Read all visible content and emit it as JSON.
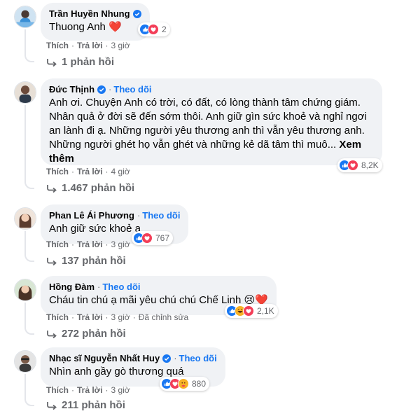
{
  "colors": {
    "brand_blue": "#1877f2",
    "bubble_bg": "#f0f2f5",
    "muted": "#65676b",
    "love_red": "#f33e58"
  },
  "labels": {
    "like": "Thích",
    "reply": "Trả lời",
    "follow": "Theo dõi",
    "see_more": "Xem thêm",
    "separator": "·"
  },
  "comments": [
    {
      "name": "Trần Huyền Nhung",
      "verified": true,
      "follow": false,
      "text": "Thuong Anh ❤️",
      "reactions": [
        "like-icon",
        "love-icon"
      ],
      "reaction_count": "2",
      "time": "3 giờ",
      "edited": "",
      "replies": "1 phản hồi"
    },
    {
      "name": "Đức Thịnh",
      "verified": true,
      "follow": true,
      "text": "Anh ơi. Chuyện Anh có trời, có đất, có lòng thành tâm chứng giám. Nhân quả ở đời sẽ đến sớm thôi. Anh giữ gìn sức khoẻ và nghỉ ngơi an lành đi ạ. Những người yêu thương anh thì vẫn yêu thương anh. Những người ghét họ vẫn ghét và những kẻ dã tâm thì muô...",
      "reactions": [
        "like-icon",
        "love-icon"
      ],
      "reaction_count": "8,2K",
      "time": "4 giờ",
      "edited": "",
      "replies": "1.467 phản hồi"
    },
    {
      "name": "Phan Lê Ái Phương",
      "verified": false,
      "follow": true,
      "text": "Anh giữ sức khoẻ ạ",
      "reactions": [
        "like-icon",
        "love-icon"
      ],
      "reaction_count": "767",
      "time": "3 giờ",
      "edited": "",
      "replies": "137 phản hồi"
    },
    {
      "name": "Hồng Đàm",
      "verified": false,
      "follow": true,
      "text": "Cháu tin chú ạ mãi yêu chú chú Chế Linh 😢❤️",
      "reactions": [
        "like-icon",
        "haha-icon",
        "love-icon"
      ],
      "reaction_count": "2,1K",
      "time": "3 giờ",
      "edited": "Đã chỉnh sửa",
      "replies": "272 phản hồi"
    },
    {
      "name": "Nhạc sĩ Nguyễn Nhất Huy",
      "verified": true,
      "follow": true,
      "text": "Nhìn anh gầy gò thương quá",
      "reactions": [
        "like-icon",
        "love-icon",
        "care-icon"
      ],
      "reaction_count": "880",
      "time": "3 giờ",
      "edited": "",
      "replies": "211 phản hồi"
    }
  ]
}
